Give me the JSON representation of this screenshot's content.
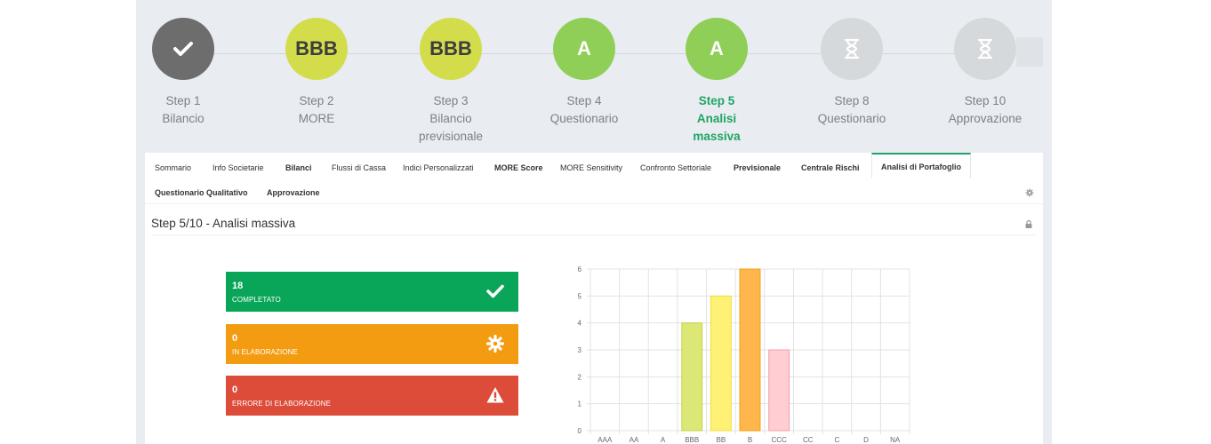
{
  "stepper": {
    "steps": [
      {
        "line1": "Step 1",
        "line2": "Bilancio",
        "line3": "",
        "badge": "",
        "icon": "check-icon",
        "status": "done"
      },
      {
        "line1": "Step 2",
        "line2": "MORE",
        "line3": "",
        "badge": "BBB",
        "icon": "",
        "status": "done"
      },
      {
        "line1": "Step 3",
        "line2": "Bilancio",
        "line3": "previsionale",
        "badge": "BBB",
        "icon": "",
        "status": "done"
      },
      {
        "line1": "Step 4",
        "line2": "Questionario",
        "line3": "",
        "badge": "A",
        "icon": "",
        "status": "done"
      },
      {
        "line1": "Step 5",
        "line2": "Analisi",
        "line3": "massiva",
        "badge": "A",
        "icon": "",
        "status": "active"
      },
      {
        "line1": "Step 8",
        "line2": "Questionario",
        "line3": "",
        "badge": "",
        "icon": "hourglass-icon",
        "status": "pending"
      },
      {
        "line1": "Step 10",
        "line2": "Approvazione",
        "line3": "",
        "badge": "",
        "icon": "hourglass-icon",
        "status": "pending"
      }
    ]
  },
  "tabs": [
    {
      "label": "Sommario",
      "bold": false
    },
    {
      "label": "Info Societarie",
      "bold": false
    },
    {
      "label": "Bilanci",
      "bold": true
    },
    {
      "label": "Flussi di Cassa",
      "bold": false
    },
    {
      "label": "Indici Personalizzati",
      "bold": false
    },
    {
      "label": "MORE Score",
      "bold": true
    },
    {
      "label": "MORE Sensitivity",
      "bold": false
    },
    {
      "label": "Confronto Settoriale",
      "bold": false
    },
    {
      "label": "Previsionale",
      "bold": true
    },
    {
      "label": "Centrale Rischi",
      "bold": true
    },
    {
      "label": "Analisi di Portafoglio",
      "bold": true,
      "active": true
    },
    {
      "label": "Questionario Qualitativo",
      "bold": true
    },
    {
      "label": "Approvazione",
      "bold": true
    }
  ],
  "section": {
    "title": "Step 5/10 - Analisi massiva"
  },
  "status_boxes": [
    {
      "count": "18",
      "label": "COMPLETATO",
      "icon": "check-icon",
      "color": "#09a559"
    },
    {
      "count": "0",
      "label": "IN ELABORAZIONE",
      "icon": "gear-icon",
      "color": "#f39c12"
    },
    {
      "count": "0",
      "label": "ERRORE DI ELABORAZIONE",
      "icon": "warning-icon",
      "color": "#dd4b39"
    }
  ],
  "colors": {
    "accent": "#1fa463",
    "bbb": "#d3dd4c",
    "a": "#8fcf58",
    "done": "#6d6d6d",
    "pending": "#d6d9dc"
  },
  "chart_data": {
    "type": "bar",
    "categories": [
      "AAA",
      "AA",
      "A",
      "BBB",
      "BB",
      "B",
      "CCC",
      "CC",
      "C",
      "D",
      "NA"
    ],
    "values": [
      0,
      0,
      0,
      4,
      5,
      6,
      3,
      0,
      0,
      0,
      0
    ],
    "bar_colors": [
      "#cccccc",
      "#cccccc",
      "#cccccc",
      "#dce775",
      "#fff176",
      "#ffb74d",
      "#ffcdd2",
      "#cccccc",
      "#cccccc",
      "#cccccc",
      "#cccccc"
    ],
    "bar_borders": [
      "#999999",
      "#999999",
      "#999999",
      "#c6d34a",
      "#f2df3c",
      "#f39c12",
      "#f2a0a8",
      "#999999",
      "#999999",
      "#999999",
      "#999999"
    ],
    "ylim": [
      0,
      6
    ],
    "yticks": [
      "0",
      "1",
      "2",
      "3",
      "4",
      "5",
      "6"
    ],
    "grid": true,
    "title": "",
    "xlabel": "",
    "ylabel": ""
  }
}
